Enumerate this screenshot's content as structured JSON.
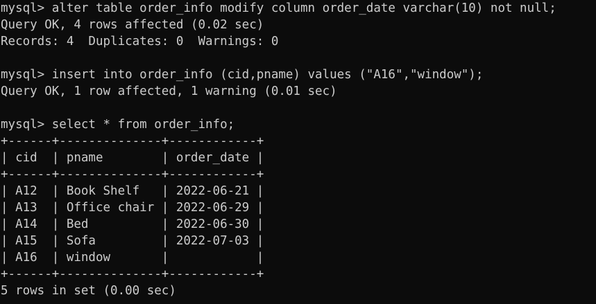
{
  "colors": {
    "background": "#0c0c0c",
    "foreground": "#cccccc"
  },
  "session": [
    {
      "type": "command",
      "text": "mysql> alter table order_info modify column order_date varchar(10) not null;"
    },
    {
      "type": "output",
      "text": "Query OK, 4 rows affected (0.02 sec)"
    },
    {
      "type": "output",
      "text": "Records: 4  Duplicates: 0  Warnings: 0"
    },
    {
      "type": "blank",
      "text": ""
    },
    {
      "type": "command",
      "text": "mysql> insert into order_info (cid,pname) values (\"A16\",\"window\");"
    },
    {
      "type": "output",
      "text": "Query OK, 1 row affected, 1 warning (0.01 sec)"
    },
    {
      "type": "blank",
      "text": ""
    },
    {
      "type": "command",
      "text": "mysql> select * from order_info;"
    }
  ],
  "result_table": {
    "border": "+------+--------------+------------+",
    "header": "| cid  | pname        | order_date |",
    "rows": [
      "| A12  | Book Shelf   | 2022-06-21 |",
      "| A13  | Office chair | 2022-06-29 |",
      "| A14  | Bed          | 2022-06-30 |",
      "| A15  | Sofa         | 2022-07-03 |",
      "| A16  | window       |            |"
    ],
    "columns": [
      "cid",
      "pname",
      "order_date"
    ],
    "values": [
      [
        "A12",
        "Book Shelf",
        "2022-06-21"
      ],
      [
        "A13",
        "Office chair",
        "2022-06-29"
      ],
      [
        "A14",
        "Bed",
        "2022-06-30"
      ],
      [
        "A15",
        "Sofa",
        "2022-07-03"
      ],
      [
        "A16",
        "window",
        ""
      ]
    ]
  },
  "footer": "5 rows in set (0.00 sec)"
}
